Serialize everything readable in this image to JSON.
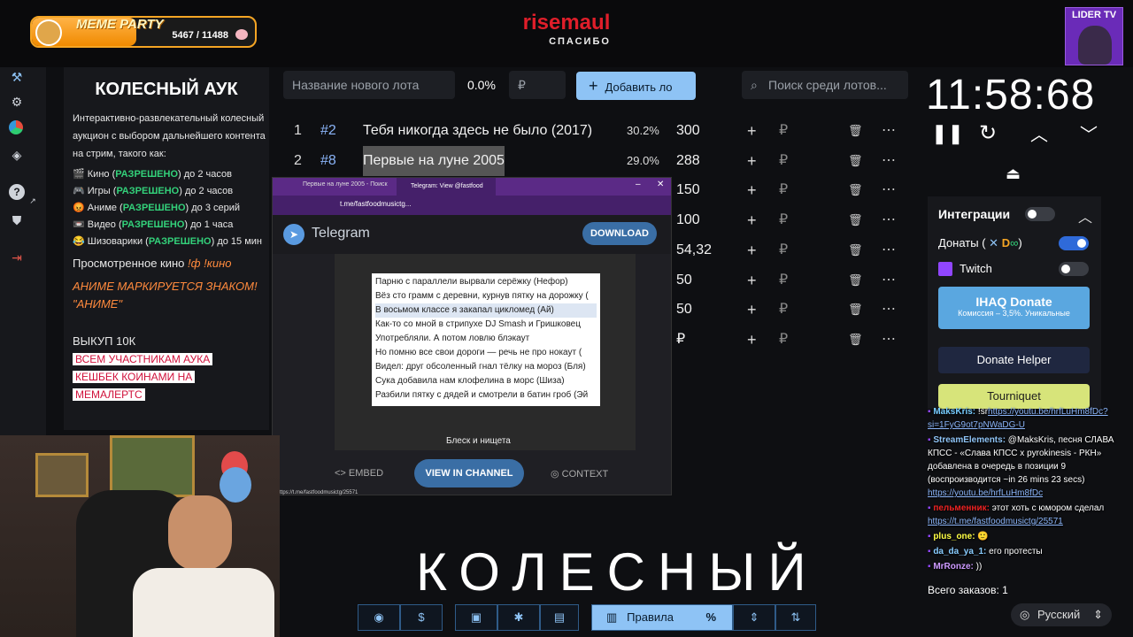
{
  "meme": {
    "name": "MEME PARTY",
    "count": "5467 / 11488",
    "progress": 0.47
  },
  "brand": {
    "name": "risemaul",
    "sub": "СПАСИБО"
  },
  "lider": {
    "label": "LIDER TV"
  },
  "nav": {
    "icons": [
      "hammer-icon",
      "gear-icon",
      "pie-chart-icon",
      "layers-icon",
      "help-icon",
      "external-link-icon",
      "shield-icon",
      "logout-icon"
    ]
  },
  "rules": {
    "title": "КОЛЕСНЫЙ АУК",
    "intro": [
      "Интерактивно-развлекательный колесный",
      "аукцион с выбором дальнейшего контента",
      "на стрим, такого как:"
    ],
    "items": [
      {
        "emoji": "🎬",
        "name": "Кино (",
        "status": "РАЗРЕШЕНО",
        "limit": ") до 2 часов"
      },
      {
        "emoji": "🎮",
        "name": "Игры (",
        "status": "РАЗРЕШЕНО",
        "limit": ") до 2 часов"
      },
      {
        "emoji": "😡",
        "name": "Аниме (",
        "status": "РАЗРЕШЕНО",
        "limit": ") до 3 серий"
      },
      {
        "emoji": "📼",
        "name": "Видео (",
        "status": "РАЗРЕШЕНО",
        "limit": ") до 1 часа"
      },
      {
        "emoji": "😂",
        "name": "Шизоварики (",
        "status": "РАЗРЕШЕНО",
        "limit": ") до 15 мин"
      }
    ],
    "watched_prefix": "Просмотренное кино ",
    "watched_cmd": "!ф !кино",
    "anime_note": "АНИМЕ МАРКИРУЕТСЯ ЗНАКОМ! \"АНИМЕ\"",
    "buyout": "ВЫКУП 10К",
    "hl1": "ВСЕМ УЧАСТНИКАМ АУКА",
    "hl2": "КЕШБЕК КОИНАМИ НА",
    "hl3": "МЕМАЛЕРТС"
  },
  "inputs": {
    "lot_placeholder": "Название нового лота",
    "percent": "0.0%",
    "currency": "₽",
    "add_label": "Добавить ло",
    "search_placeholder": "Поиск среди лотов..."
  },
  "lots": [
    {
      "n": "1",
      "id": "#2",
      "title": "Тебя никогда здесь не было (2017)",
      "pct": "30.2%",
      "amount": "300"
    },
    {
      "n": "2",
      "id": "#8",
      "title": "Первые на луне 2005",
      "pct": "29.0%",
      "amount": "288"
    },
    {
      "n": "",
      "id": "",
      "title": "",
      "pct": "",
      "amount": "150"
    },
    {
      "n": "",
      "id": "",
      "title": "",
      "pct": "",
      "amount": "100"
    },
    {
      "n": "",
      "id": "",
      "title": "",
      "pct": "",
      "amount": "54,32"
    },
    {
      "n": "",
      "id": "",
      "title": "",
      "pct": "",
      "amount": "50"
    },
    {
      "n": "",
      "id": "",
      "title": "",
      "pct": "",
      "amount": "50"
    },
    {
      "n": "",
      "id": "",
      "title": "",
      "pct": "",
      "amount": "₽"
    }
  ],
  "telegram": {
    "tab1": "Первые на луне 2005 - Поиск",
    "tab2": "Telegram: View @fastfood",
    "url": "t.me/fastfoodmusictg...",
    "title": "Telegram",
    "download": "DOWNLOAD",
    "lines": [
      "Парню с параллели вырвали серёжку (Нефор)",
      "Вёз сто грамм с деревни, курнув пятку на дорожку (",
      "В восьмом классе я закапал цикломед (Ай)",
      "Как-то со мной в стрипухе DJ Smash и Гришковец",
      "Употребляли. А потом ловлю блэкаут",
      "Но помню все свои дороги — речь не про нокаут (",
      "Видел: друг обсоленный гнал тёлку на мороз (Бля)",
      "Сука добавила нам клофелина в морс (Шиза)",
      "Разбили пятку с дядей и смотрели в батин гроб (Эй"
    ],
    "video_title": "Блеск и нищета",
    "embed": "EMBED",
    "view": "VIEW IN CHANNEL",
    "context": "CONTEXT",
    "status_url": "ttps://t.me/fastfoodmusictg/25571"
  },
  "timer": {
    "value": "11:58:68"
  },
  "integrations": {
    "title": "Интеграции",
    "donations": "Донаты (",
    "donations_end": ")",
    "twitch": "Twitch",
    "ihaq": "IHAQ Donate",
    "ihaq_sub": "Комиссия – 3,5%. Уникальные ",
    "helper": "Donate Helper",
    "tourniquet": "Tourniquet",
    "colors": {
      "ihaq": "#5aa7e0",
      "helper": "#1f2740",
      "tourniquet": "#d7e47a"
    }
  },
  "chat": [
    {
      "user": "MaksKris:",
      "text": " !sr",
      "link": "https://youtu.be/hrfLuHm8fDc? si=1FyG9ot7pNWaDG-U"
    },
    {
      "user": "StreamElements:",
      "text": " @MaksKris, песня СЛАВА КПСС - «Слава КПСС x pyrokinesis - РКН» добавлена в очередь в позиции 9 (воспроизводится ~in 26 mins 23 secs) ",
      "link": "https://youtu.be/hrfLuHm8fDc"
    },
    {
      "user": "пельменник:",
      "text": " этот хоть с юмором сделал ",
      "link": "https://t.me/fastfoodmusictg/25571"
    },
    {
      "user": "plus_one:",
      "text": " 🙂",
      "link": ""
    },
    {
      "user": "da_da_ya_1:",
      "text": " его протесты",
      "link": ""
    },
    {
      "user": "MrRonze:",
      "text": " ))",
      "link": ""
    }
  ],
  "orders": {
    "label": "Всего заказов:",
    "value": "1"
  },
  "bigword": "КОЛЕСНЫЙ",
  "toolbar": {
    "rules_label": "Правила",
    "percent_label": "%"
  },
  "language": "Русский"
}
